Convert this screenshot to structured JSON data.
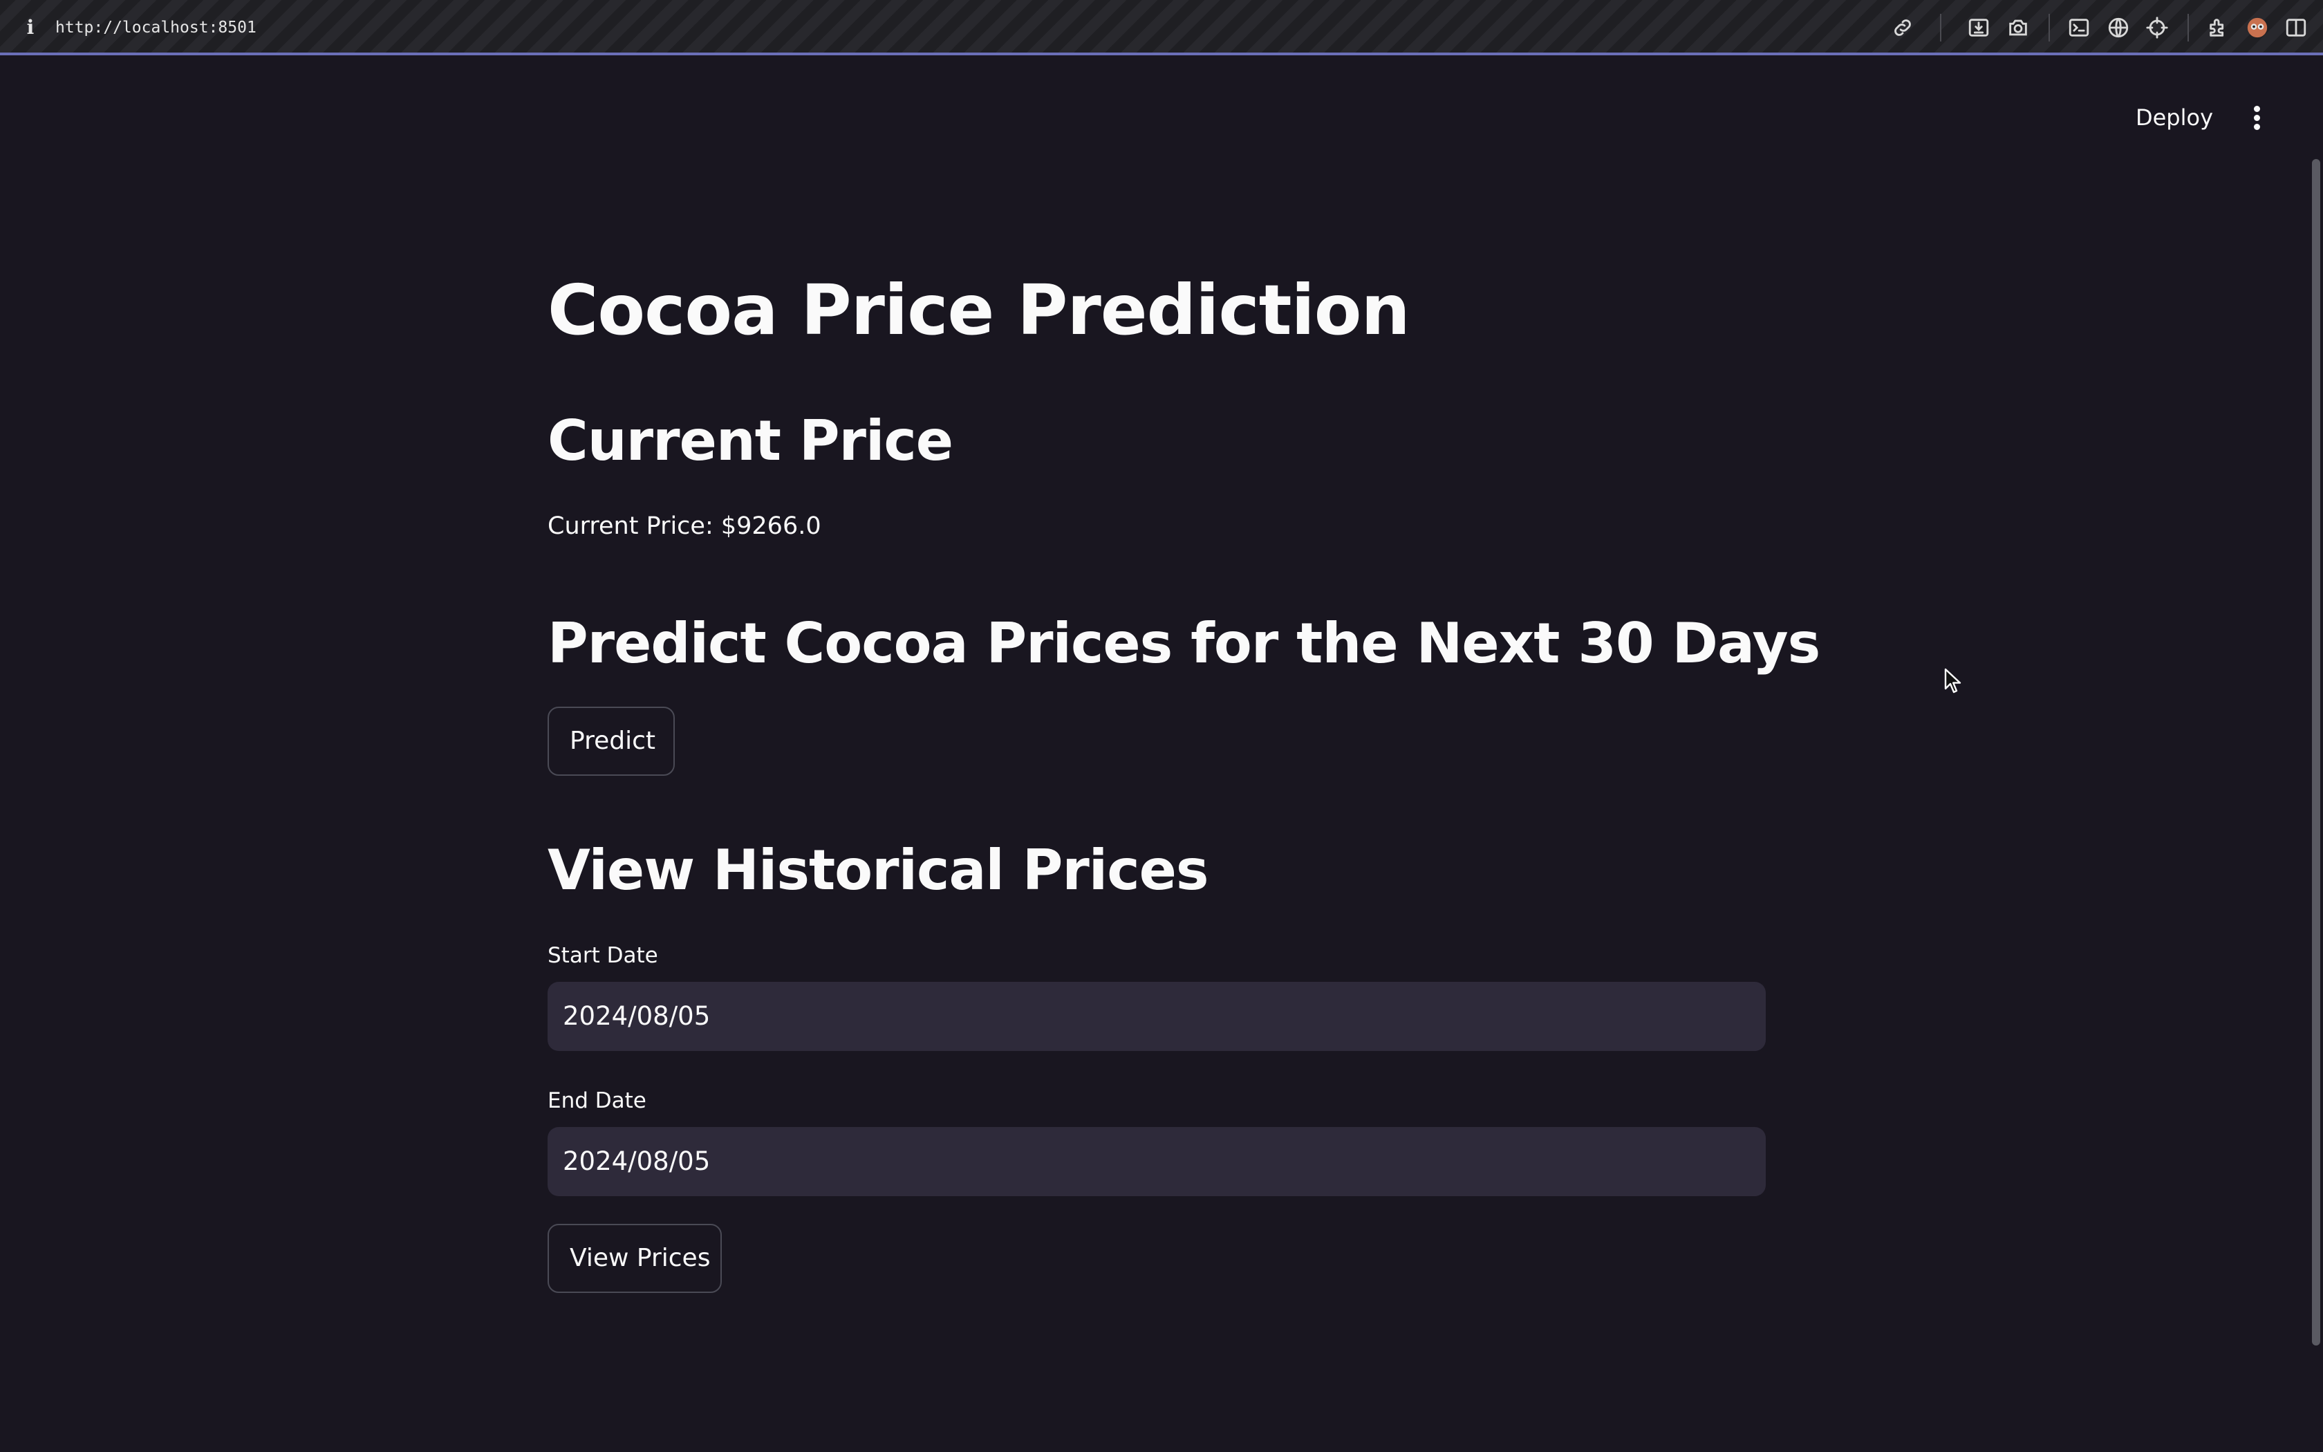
{
  "browser": {
    "url": "http://localhost:8501",
    "info_glyph": "i",
    "icons": [
      "link-icon",
      "download-icon",
      "camera-icon",
      "terminal-icon",
      "globe-icon",
      "crosshair-icon",
      "extension-icon",
      "avatar-icon",
      "sidebar-icon"
    ]
  },
  "header": {
    "deploy_label": "Deploy",
    "menu_icon": "more-vertical-icon"
  },
  "main": {
    "title": "Cocoa Price Prediction",
    "current_section": {
      "heading": "Current Price",
      "text": "Current Price: $9266.0"
    },
    "predict_section": {
      "heading": "Predict Cocoa Prices for the Next 30 Days",
      "button_label": "Predict"
    },
    "history_section": {
      "heading": "View Historical Prices",
      "start_label": "Start Date",
      "start_value": "2024/08/05",
      "end_label": "End Date",
      "end_value": "2024/08/05",
      "button_label": "View Prices"
    }
  },
  "colors": {
    "background": "#191620",
    "input_background": "#2e2a3a",
    "text": "#fafafa",
    "toolbar_accent": "#6b6fb8"
  }
}
